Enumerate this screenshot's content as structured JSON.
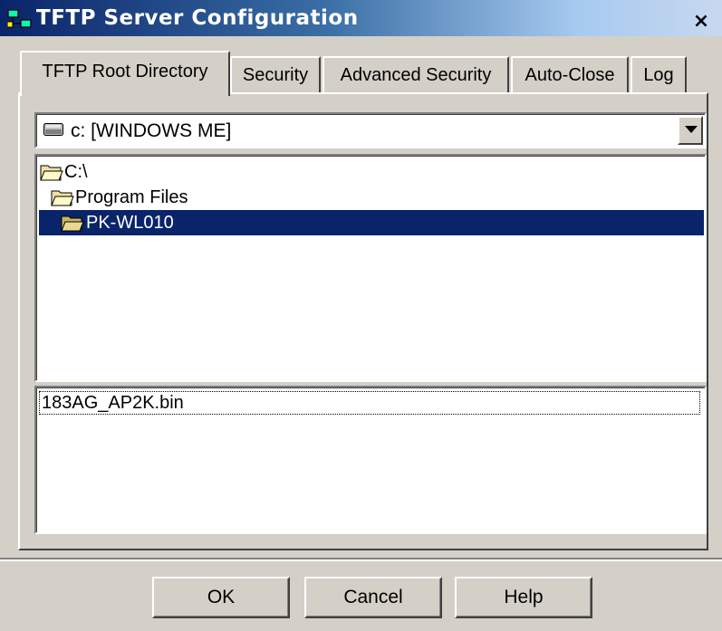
{
  "window": {
    "title": "TFTP Server Configuration",
    "close_label": "×"
  },
  "tabs": [
    {
      "label": "TFTP Root Directory",
      "active": true
    },
    {
      "label": "Security",
      "active": false
    },
    {
      "label": "Advanced Security",
      "active": false
    },
    {
      "label": "Auto-Close",
      "active": false
    },
    {
      "label": "Log",
      "active": false
    }
  ],
  "drive_select": {
    "value": "c: [WINDOWS ME]",
    "icon": "drive-icon"
  },
  "folder_tree": {
    "items": [
      {
        "label": "C:\\",
        "icon": "open-folder-icon"
      },
      {
        "label": "Program Files",
        "icon": "open-folder-icon"
      },
      {
        "label": "PK-WL010",
        "icon": "open-folder-icon",
        "selected": true
      }
    ]
  },
  "file_list": {
    "items": [
      {
        "label": "183AG_AP2K.bin"
      }
    ]
  },
  "buttons": {
    "ok": "OK",
    "cancel": "Cancel",
    "help": "Help"
  },
  "colors": {
    "title_gradient_start": "#0a246a",
    "title_gradient_end": "#c8d8f0",
    "selection": "#0a246a",
    "face": "#d4d0c8"
  }
}
